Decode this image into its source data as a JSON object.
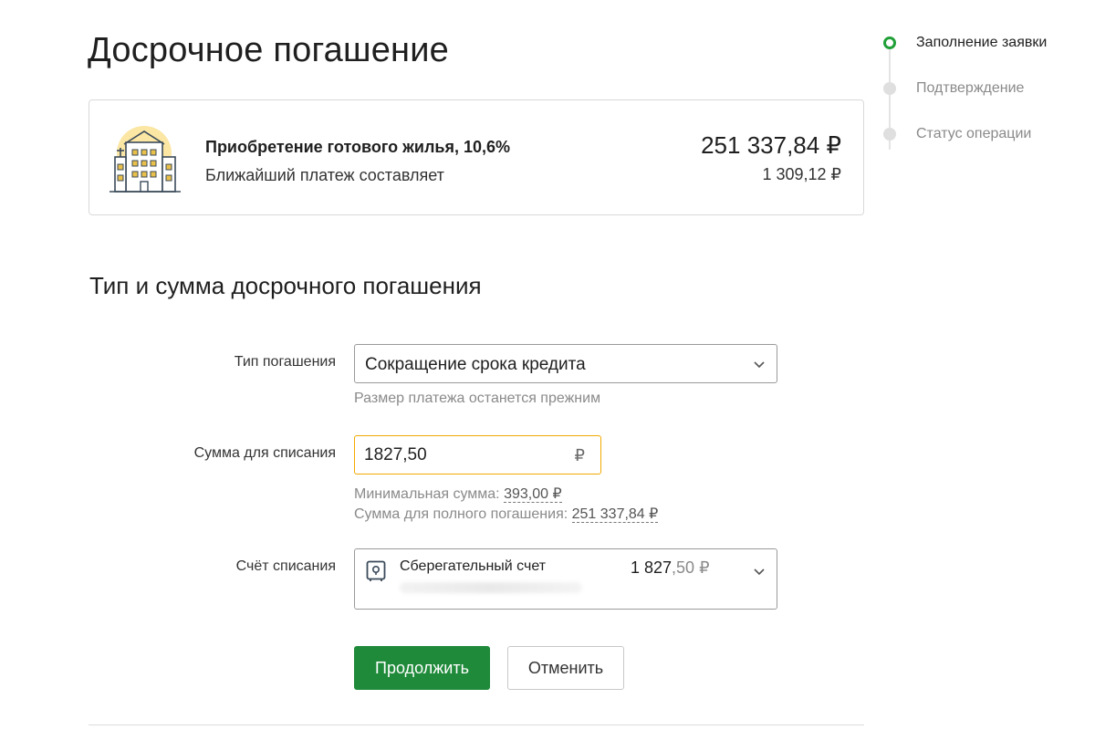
{
  "page": {
    "title": "Досрочное погашение"
  },
  "loan": {
    "name": "Приобретение готового жилья, 10,6%",
    "next_payment_label": "Ближайший платеж составляет",
    "balance": "251 337,84 ₽",
    "next_payment": "1 309,12 ₽",
    "icon": "apartment-building-icon"
  },
  "stepper": {
    "steps": [
      {
        "label": "Заполнение заявки",
        "active": true
      },
      {
        "label": "Подтверждение",
        "active": false
      },
      {
        "label": "Статус операции",
        "active": false
      }
    ]
  },
  "section": {
    "title": "Тип и сумма досрочного погашения"
  },
  "form": {
    "type": {
      "label": "Тип погашения",
      "value": "Сокращение срока кредита",
      "hint": "Размер платежа останется прежним"
    },
    "amount": {
      "label": "Сумма для списания",
      "value": "1827,50",
      "currency": "₽",
      "min_label": "Минимальная сумма:",
      "min_value": "393,00 ₽",
      "full_label": "Сумма для полного погашения:",
      "full_value": "251 337,84 ₽"
    },
    "account": {
      "label": "Счёт списания",
      "name": "Сберегательный счет",
      "amount_int": "1 827",
      "amount_frac": ",50 ₽",
      "icon": "safe-icon"
    }
  },
  "buttons": {
    "continue": "Продолжить",
    "cancel": "Отменить"
  },
  "colors": {
    "accent": "#21a038",
    "primary_button": "#1f8a3a",
    "input_focus": "#f2a900"
  }
}
